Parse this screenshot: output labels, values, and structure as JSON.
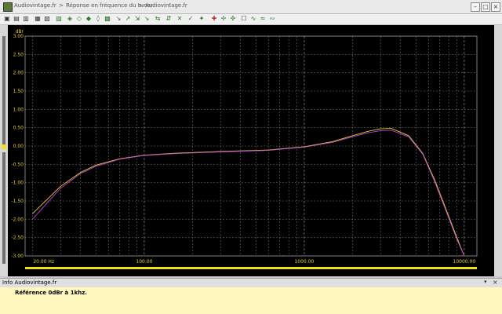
{
  "window": {
    "breadcrumbs": [
      "Audiovintage.fr",
      "Réponse en fréquence du tuner",
      "Audiovintage.fr"
    ],
    "separator": ">"
  },
  "toolbar": {
    "icons": [
      "open-icon",
      "save-icon",
      "print-icon",
      "chart-icon",
      "table-icon",
      "copy-icon",
      "zoom-in-icon",
      "zoom-out-icon",
      "zoom-x-icon",
      "zoom-y-icon",
      "fit-icon",
      "arrow-icon",
      "arrow-up-icon",
      "pan-icon",
      "cursor-icon",
      "measure-icon",
      "marker-icon",
      "wave-icon",
      "settings-icon"
    ]
  },
  "chart_data": {
    "type": "line",
    "ylabel": "dBr",
    "xscale": "log",
    "xlim": [
      18,
      12000
    ],
    "ylim": [
      -3.0,
      3.0
    ],
    "y_ticks": [
      "3.00",
      "2.50",
      "2.00",
      "1.50",
      "1.00",
      "0.50",
      "0.00",
      "-0.50",
      "-1.00",
      "-1.50",
      "-2.00",
      "-2.50",
      "-3.00"
    ],
    "x_tick_labels": [
      {
        "value": 20,
        "label": "20.00 Hz"
      },
      {
        "value": 100,
        "label": "100.00"
      },
      {
        "value": 1000,
        "label": "1000.00"
      },
      {
        "value": 10000,
        "label": "10000.00"
      }
    ],
    "grid": true,
    "series": [
      {
        "color": "#e0d030",
        "points": [
          [
            20,
            -1.85
          ],
          [
            30,
            -1.1
          ],
          [
            40,
            -0.72
          ],
          [
            50,
            -0.52
          ],
          [
            70,
            -0.35
          ],
          [
            100,
            -0.25
          ],
          [
            150,
            -0.2
          ],
          [
            300,
            -0.15
          ],
          [
            600,
            -0.11
          ],
          [
            1000,
            -0.02
          ],
          [
            1500,
            0.12
          ],
          [
            2000,
            0.28
          ],
          [
            2500,
            0.4
          ],
          [
            3000,
            0.47
          ],
          [
            3500,
            0.48
          ],
          [
            4500,
            0.28
          ],
          [
            5500,
            -0.2
          ],
          [
            6500,
            -0.9
          ],
          [
            7500,
            -1.6
          ],
          [
            9000,
            -2.5
          ],
          [
            10000,
            -3.0
          ]
        ]
      },
      {
        "color": "#c040e0",
        "points": [
          [
            20,
            -2.0
          ],
          [
            30,
            -1.15
          ],
          [
            40,
            -0.75
          ],
          [
            50,
            -0.55
          ],
          [
            70,
            -0.36
          ],
          [
            100,
            -0.26
          ],
          [
            150,
            -0.21
          ],
          [
            300,
            -0.16
          ],
          [
            600,
            -0.12
          ],
          [
            1000,
            -0.03
          ],
          [
            1500,
            0.1
          ],
          [
            2000,
            0.25
          ],
          [
            2500,
            0.36
          ],
          [
            3000,
            0.42
          ],
          [
            3500,
            0.43
          ],
          [
            4500,
            0.25
          ],
          [
            5500,
            -0.22
          ],
          [
            6500,
            -0.95
          ],
          [
            7500,
            -1.65
          ],
          [
            9000,
            -2.55
          ],
          [
            10000,
            -3.0
          ]
        ]
      }
    ]
  },
  "info": {
    "title": "Info Audiovintage.fr",
    "text": "Référence 0dBr à 1khz."
  },
  "colors": {
    "grid": "#7a7a7a",
    "axis_text": "#e0d030",
    "background": "#000000"
  }
}
